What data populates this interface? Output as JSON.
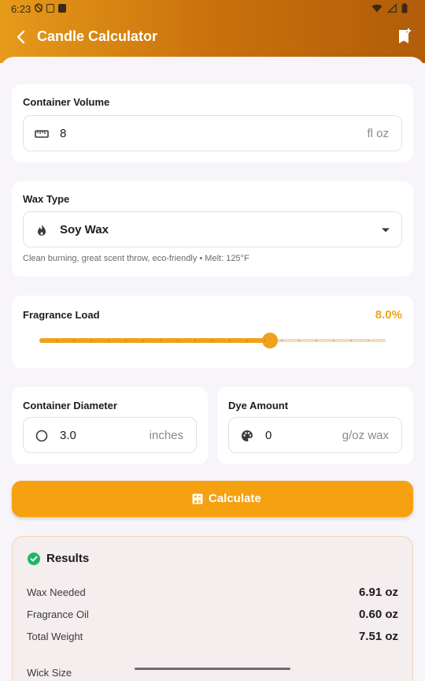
{
  "status_bar": {
    "time": "6:23"
  },
  "app_bar": {
    "title": "Candle Calculator"
  },
  "container_volume": {
    "label": "Container Volume",
    "value": "8",
    "unit": "fl oz"
  },
  "wax_type": {
    "label": "Wax Type",
    "selected": "Soy Wax",
    "description": "Clean burning, great scent throw, eco-friendly • Melt: 125°F"
  },
  "fragrance_load": {
    "label": "Fragrance Load",
    "value_text": "8.0%",
    "value_fraction": 0.665,
    "ticks": 20
  },
  "container_diameter": {
    "label": "Container Diameter",
    "value": "3.0",
    "unit": "inches"
  },
  "dye_amount": {
    "label": "Dye Amount",
    "value": "0",
    "unit": "g/oz wax"
  },
  "calculate_button": {
    "label": "Calculate"
  },
  "results": {
    "title": "Results",
    "rows": [
      {
        "label": "Wax Needed",
        "value": "6.91 oz"
      },
      {
        "label": "Fragrance Oil",
        "value": "0.60 oz"
      },
      {
        "label": "Total Weight",
        "value": "7.51 oz"
      },
      {
        "label": "Wick Size",
        "value": ""
      }
    ]
  },
  "colors": {
    "accent": "#f5a112",
    "success": "#1eb768",
    "header_start": "#e69a1a",
    "header_end": "#b15d0a"
  },
  "icons": {
    "back": "arrow-back-icon",
    "bookmark": "bookmark-add-icon",
    "ruler": "ruler-icon",
    "flame": "flame-icon",
    "circle": "circle-outline-icon",
    "palette": "palette-icon",
    "calculator": "calculator-icon",
    "check": "check-circle-icon"
  }
}
